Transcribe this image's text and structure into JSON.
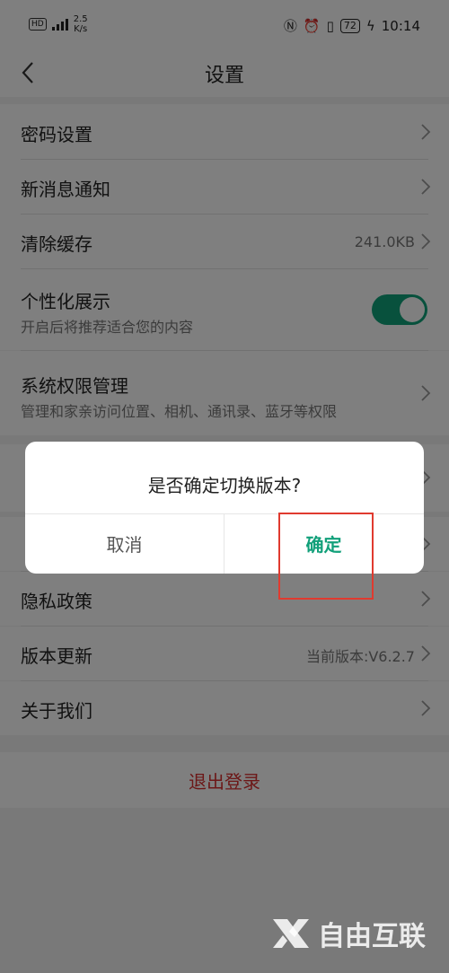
{
  "status_bar": {
    "network_badge": "HD",
    "speed_value": "2.5",
    "speed_unit": "K/s",
    "battery": "72",
    "time": "10:14"
  },
  "nav": {
    "title": "设置"
  },
  "settings": {
    "password": "密码设置",
    "notifications": "新消息通知",
    "clear_cache": "清除缓存",
    "cache_size": "241.0KB",
    "personalized": "个性化展示",
    "personalized_desc": "开启后将推荐适合您的内容",
    "personalized_on": true,
    "permissions": "系统权限管理",
    "permissions_desc": "管理和家亲访问位置、相机、通讯录、蓝牙等权限",
    "privacy": "隐私政策",
    "version_update": "版本更新",
    "current_version": "当前版本:V6.2.7",
    "about": "关于我们",
    "logout": "退出登录"
  },
  "dialog": {
    "message": "是否确定切换版本?",
    "cancel": "取消",
    "confirm": "确定"
  },
  "watermark": "自由互联",
  "colors": {
    "accent": "#12a07a",
    "danger": "#d92f2f",
    "highlight": "#e03a2f"
  }
}
